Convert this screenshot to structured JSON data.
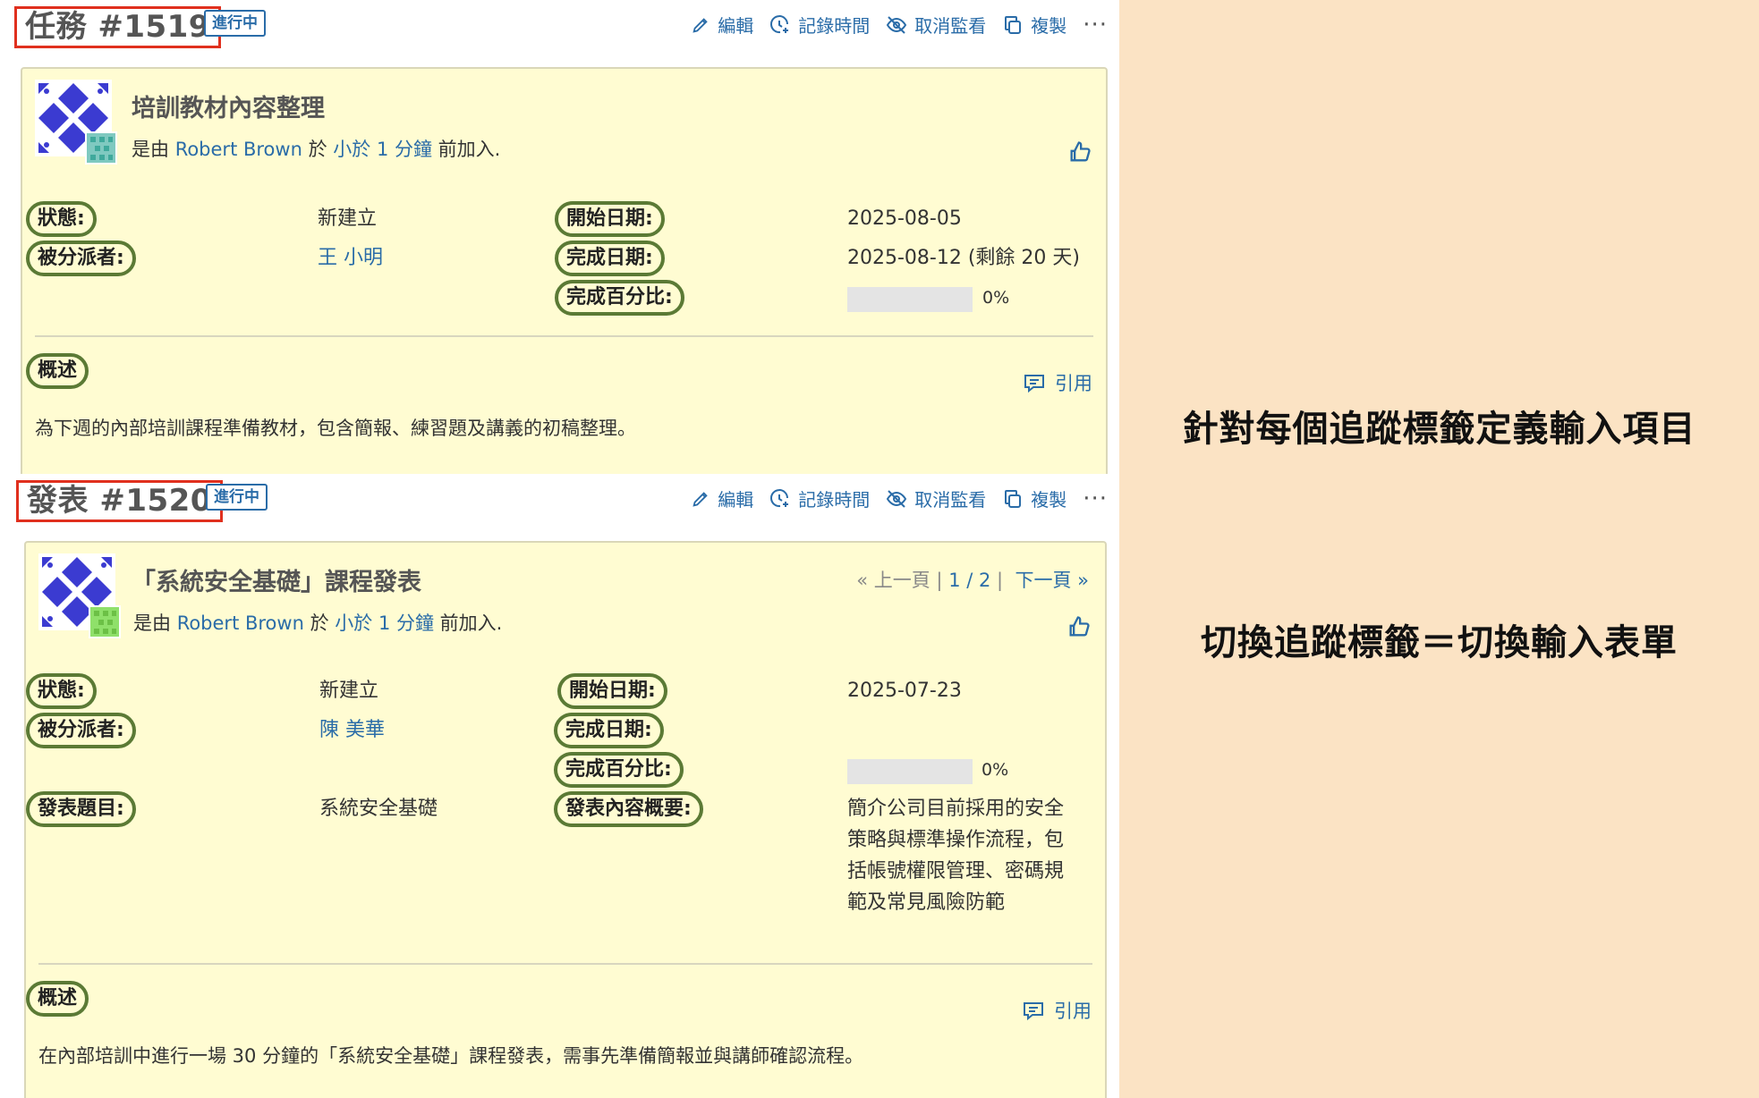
{
  "issues": [
    {
      "title": "任務 #1519",
      "status_tag": "進行中",
      "actions": {
        "edit": "編輯",
        "log_time": "記錄時間",
        "unwatch": "取消監看",
        "copy": "複製",
        "more": "···"
      },
      "subject": "培訓教材內容整理",
      "author": {
        "prefix": "是由",
        "name": "Robert Brown",
        "mid": "於",
        "time": "小於 1 分鐘",
        "suffix": "前加入."
      },
      "fields": {
        "status_label": "狀態:",
        "status_value": "新建立",
        "assignee_label": "被分派者:",
        "assignee_value": "王 小明",
        "start_label": "開始日期:",
        "start_value": "2025-08-05",
        "due_label": "完成日期:",
        "due_value": "2025-08-12 (剩餘 20 天)",
        "done_label": "完成百分比:",
        "done_value": "0%",
        "done_ratio": 0
      },
      "description_label": "概述",
      "quote": "引用",
      "description": "為下週的內部培訓課程準備教材，包含簡報、練習題及講義的初稿整理。"
    },
    {
      "title": "發表 #1520",
      "status_tag": "進行中",
      "actions": {
        "edit": "編輯",
        "log_time": "記錄時間",
        "unwatch": "取消監看",
        "copy": "複製",
        "more": "···"
      },
      "subject": "「系統安全基礎」課程發表",
      "pager": {
        "prev": "« 上一頁",
        "sep1": "|",
        "pos": "1 / 2",
        "sep2": "|",
        "next": "下一頁 »"
      },
      "author": {
        "prefix": "是由",
        "name": "Robert Brown",
        "mid": "於",
        "time": "小於 1 分鐘",
        "suffix": "前加入."
      },
      "fields": {
        "status_label": "狀態:",
        "status_value": "新建立",
        "assignee_label": "被分派者:",
        "assignee_value": "陳 美華",
        "start_label": "開始日期:",
        "start_value": "2025-07-23",
        "due_label": "完成日期:",
        "due_value": "",
        "done_label": "完成百分比:",
        "done_value": "0%",
        "done_ratio": 0,
        "topic_label": "發表題目:",
        "topic_value": "系統安全基礎",
        "summary_label": "發表內容概要:",
        "summary_value": "簡介公司目前採用的安全策略與標準操作流程，包括帳號權限管理、密碼規範及常見風險防範"
      },
      "description_label": "概述",
      "quote": "引用",
      "description": "在內部培訓中進行一場 30 分鐘的「系統安全基礎」課程發表，需事先準備簡報並與講師確認流程。"
    }
  ],
  "side_panel": {
    "line1": "針對每個追蹤標籤定義輸入項目",
    "line2": "切換追蹤標籤＝切換輸入表單"
  },
  "colors": {
    "card_bg": "#fffcd2",
    "label_outline": "#5b7a35",
    "title_outline": "#e0301e",
    "link": "#2a6ca8",
    "side_bg": "#fbe3c4"
  }
}
